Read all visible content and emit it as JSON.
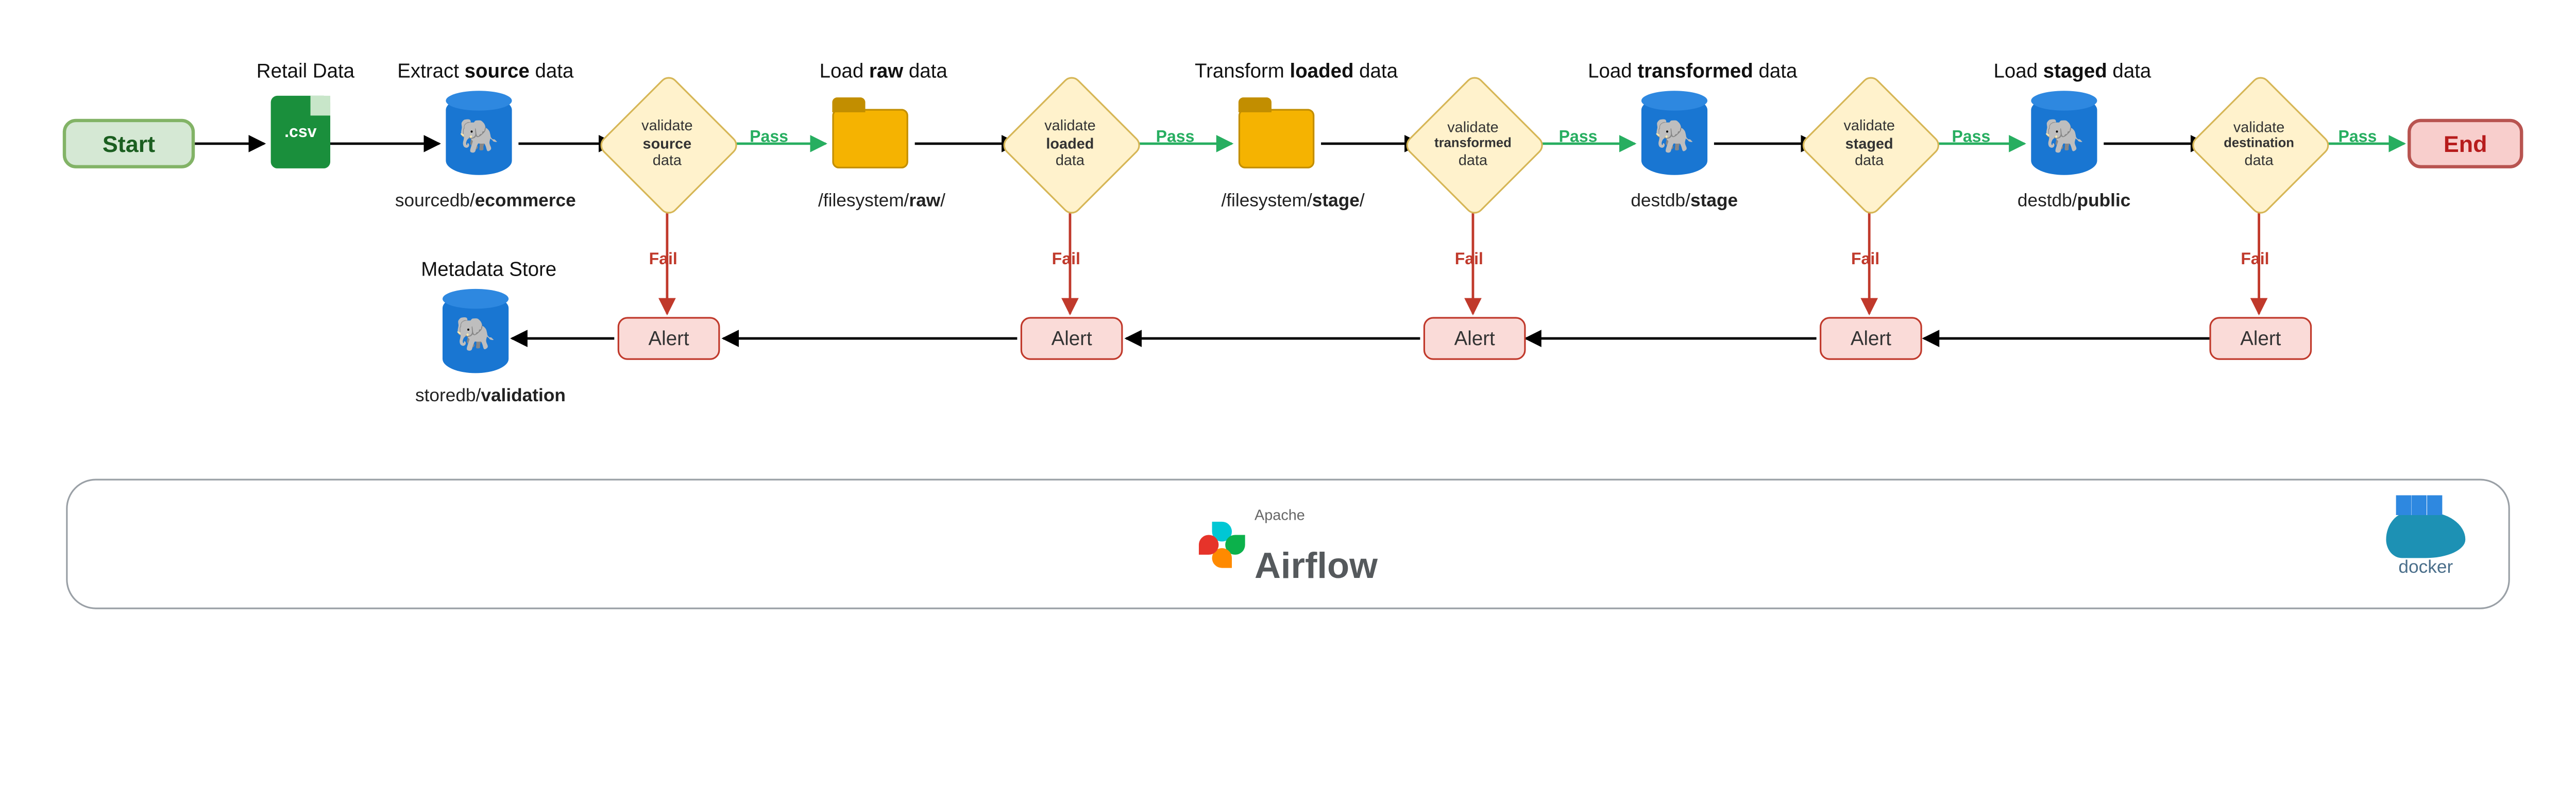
{
  "start": "Start",
  "end": "End",
  "retail": {
    "title": "Retail Data"
  },
  "source": {
    "title_pre": "Extract ",
    "title_b": "source",
    "title_post": " data",
    "sub_pre": "sourcedb/",
    "sub_b": "ecommerce"
  },
  "raw": {
    "title_pre": "Load ",
    "title_b": "raw",
    "title_post": " data",
    "sub_pre": "/filesystem/",
    "sub_b": "raw",
    "sub_post": "/"
  },
  "stage": {
    "title_pre": "Transform ",
    "title_b": "loaded",
    "title_post": " data",
    "sub_pre": "/filesystem/",
    "sub_b": "stage",
    "sub_post": "/"
  },
  "loadtrans": {
    "title_pre": "Load ",
    "title_b": "transformed",
    "title_post": " data",
    "sub_pre": "destdb/",
    "sub_b": "stage"
  },
  "loadstaged": {
    "title_pre": "Load ",
    "title_b": "staged",
    "title_post": " data",
    "sub_pre": "destdb/",
    "sub_b": "public"
  },
  "store": {
    "title": "Metadata Store",
    "sub_pre": "storedb/",
    "sub_b": "validation"
  },
  "validators": {
    "source": {
      "l1": "validate",
      "l2": "source",
      "l3": "data"
    },
    "loaded": {
      "l1": "validate",
      "l2": "loaded",
      "l3": "data"
    },
    "transformed": {
      "l1": "validate",
      "l2": "transformed",
      "l3": "data"
    },
    "staged": {
      "l1": "validate",
      "l2": "staged",
      "l3": "data"
    },
    "destination": {
      "l1": "validate",
      "l2": "destination",
      "l3": "data"
    }
  },
  "labels": {
    "pass": "Pass",
    "fail": "Fail",
    "alert": "Alert"
  },
  "footer": {
    "sup": "Apache",
    "name": "Airflow",
    "docker": "docker"
  }
}
